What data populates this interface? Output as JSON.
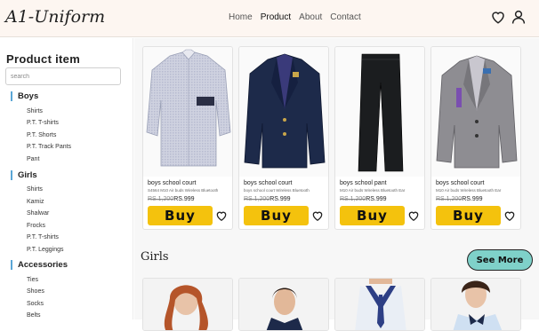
{
  "header": {
    "logo": "A1-Uniform",
    "nav": [
      "Home",
      "Product",
      "About",
      "Contact"
    ],
    "active_nav": "Product"
  },
  "sidebar": {
    "title": "Product item",
    "search_placeholder": "search",
    "categories": [
      {
        "label": "Boys",
        "items": [
          "Shirts",
          "P.T. T-shirts",
          "P.T. Shorts",
          "P.T. Track Pants",
          "Pant"
        ]
      },
      {
        "label": "Girls",
        "items": [
          "Shirts",
          "Kamiz",
          "Shalwar",
          "Frocks",
          "P.T. T-shirts",
          "P.T. Leggings"
        ]
      },
      {
        "label": "Accessories",
        "items": [
          "Ties",
          "Shoes",
          "Socks",
          "Belts"
        ]
      }
    ]
  },
  "products": [
    {
      "name": "boys school court",
      "desc": "S4564 M10 Air buds Wireless Bluetooth",
      "old_price": "RS.1,200",
      "new_price": "RS.999",
      "buy_label": "Buy"
    },
    {
      "name": "boys school court",
      "desc": "boys school court Wireless Bluetooth",
      "old_price": "RS.1,200",
      "new_price": "RS.999",
      "buy_label": "Buy"
    },
    {
      "name": "boys school pant",
      "desc": "M10 Air buds Wireless Bluetooth Ear",
      "old_price": "RS.1,200",
      "new_price": "RS.999",
      "buy_label": "Buy"
    },
    {
      "name": "boys school court",
      "desc": "M10 Air buds Wireless Bluetooth Ear",
      "old_price": "RS.1,200",
      "new_price": "RS.999",
      "buy_label": "Buy"
    }
  ],
  "section": {
    "title": "Girls",
    "see_more": "See More"
  },
  "colors": {
    "accent_yellow": "#f4c20d",
    "see_more_teal": "#7fd1c9",
    "category_bar": "#5aa6d6",
    "header_bg": "#fdf6f1"
  }
}
